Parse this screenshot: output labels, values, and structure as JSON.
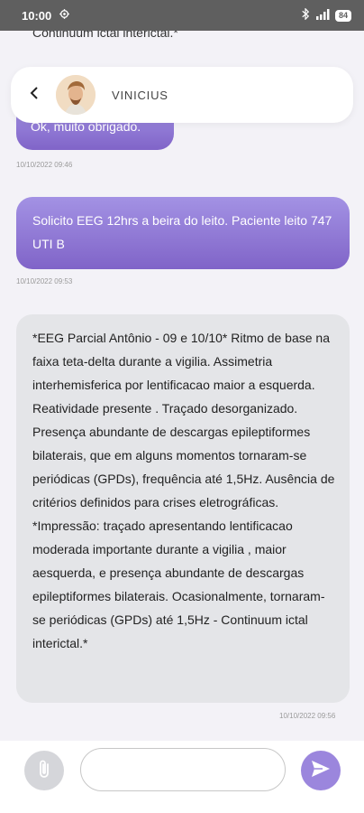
{
  "status_bar": {
    "time": "10:00",
    "battery": "84"
  },
  "header": {
    "contact_name": "VINICIUS"
  },
  "clipped_top_text": "Continuum ictal interictal.*",
  "messages": [
    {
      "direction": "sent",
      "text": "Ok, muito obrigado.",
      "timestamp": "10/10/2022 09:46"
    },
    {
      "direction": "sent",
      "text": "Solicito EEG 12hrs a beira do leito. Paciente leito 747 UTI B",
      "timestamp": "10/10/2022 09:53"
    },
    {
      "direction": "received",
      "text": "*EEG Parcial Antônio - 09 e 10/10* Ritmo de base na faixa teta-delta durante a vigilia. Assimetria interhemisferica por lentificacao maior a esquerda. Reatividade presente . Traçado desorganizado. Presença abundante de descargas epileptiformes bilaterais, que em alguns momentos tornaram-se periódicas (GPDs), frequência até 1,5Hz. Ausência de critérios definidos para crises eletrográficas. *Impressão: traçado apresentando lentificacao moderada importante durante a vigilia , maior aesquerda, e presença abundante de descargas epileptiformes bilaterais. Ocasionalmente, tornaram-se periódicas (GPDs) até 1,5Hz - Continuum ictal interictal.*",
      "timestamp": "10/10/2022 09:56"
    }
  ],
  "composer": {
    "input_value": "",
    "placeholder": ""
  },
  "colors": {
    "sent_bubble_top": "#a392e4",
    "sent_bubble_bottom": "#8064c8",
    "received_bubble": "#e4e5e8",
    "send_button": "#9b86dd",
    "attach_button": "#d5d6da"
  },
  "icons": [
    "settings-gear-icon",
    "bluetooth-icon",
    "signal-icon",
    "battery-icon",
    "back-arrow-icon",
    "paperclip-icon",
    "send-icon"
  ]
}
